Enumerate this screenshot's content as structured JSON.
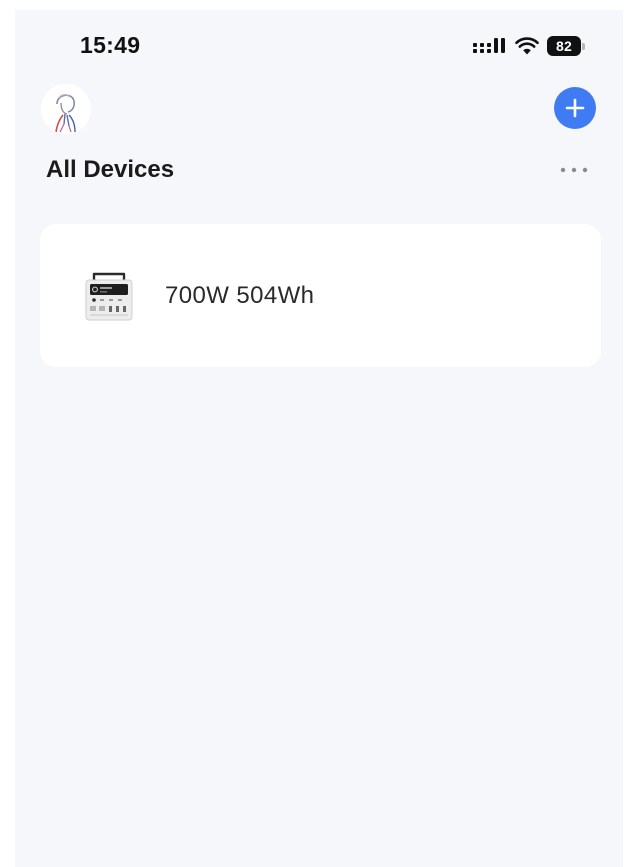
{
  "status_bar": {
    "time": "15:49",
    "battery_level": "82",
    "icons": [
      "signal-icon",
      "wifi-icon",
      "battery-icon"
    ]
  },
  "header": {
    "avatar_icon": "avatar-illustration",
    "add_icon": "plus-icon",
    "more_icon": "ellipsis-icon"
  },
  "page": {
    "title": "All Devices"
  },
  "devices": [
    {
      "name": "700W  504Wh",
      "icon": "power-station-icon"
    }
  ],
  "colors": {
    "background": "#f5f7fb",
    "card": "#ffffff",
    "accent": "#3f7cf3",
    "text": "#1b1b1b"
  }
}
